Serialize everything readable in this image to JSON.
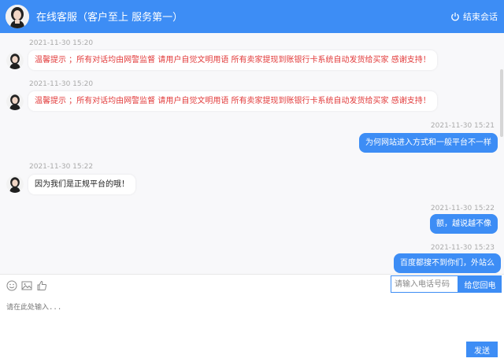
{
  "header": {
    "title": "在线客服（客户至上 服务第一）",
    "end_label": "结束会话",
    "avatar_icon": "agent-avatar-icon",
    "end_icon": "power-icon"
  },
  "messages": [
    {
      "side": "left",
      "time": "2021-11-30 15:20",
      "text": "温馨提示 ；所有对话均由网警监督  请用户自觉文明用语  所有卖家提现到账银行卡系统自动发货给买家 感谢支持！",
      "style": "warning"
    },
    {
      "side": "left",
      "time": "2021-11-30 15:20",
      "text": "温馨提示 ；所有对话均由网警监督  请用户自觉文明用语  所有卖家提现到账银行卡系统自动发货给买家 感谢支持！",
      "style": "warning"
    },
    {
      "side": "right",
      "time": "2021-11-30 15:21",
      "text": "为何网站进入方式和一般平台不一样"
    },
    {
      "side": "left",
      "time": "2021-11-30 15:22",
      "text": "因为我们是正规平台的哦！"
    },
    {
      "side": "right",
      "time": "2021-11-30 15:22",
      "text": "额，越说越不像"
    },
    {
      "side": "right",
      "time": "2021-11-30 15:23",
      "text": "百度都搜不到你们，外站么"
    }
  ],
  "toolbar": {
    "icons": [
      "emoji-icon",
      "image-icon",
      "thumbs-up-icon"
    ],
    "phone_placeholder": "请输入电话号码",
    "callback_label": "给您回电"
  },
  "composer": {
    "placeholder": "请在此处输入...",
    "send_label": "发送"
  },
  "colors": {
    "accent": "#3d8df5",
    "warning_text": "#e23b3b",
    "chat_bg": "#f8f8fa"
  }
}
